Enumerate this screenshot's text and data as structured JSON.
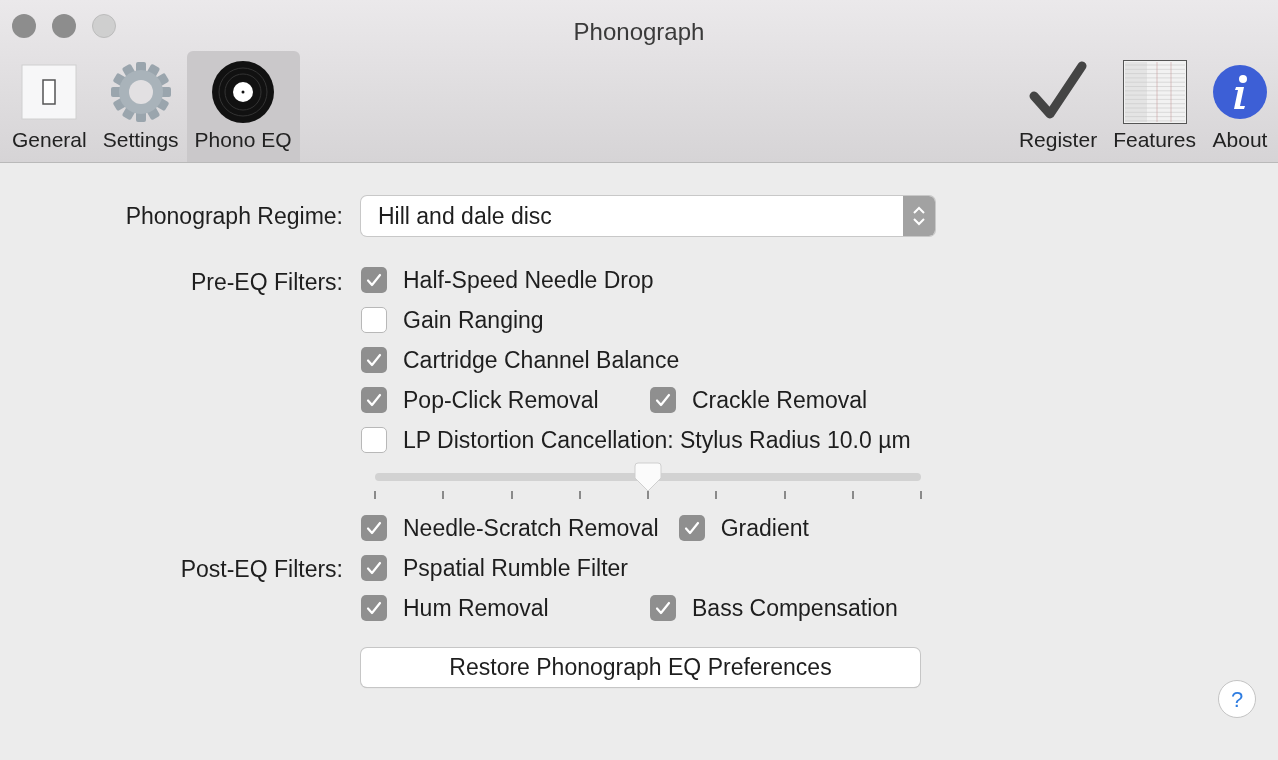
{
  "window": {
    "title": "Phonograph"
  },
  "toolbar": [
    {
      "label": "General",
      "selected": false
    },
    {
      "label": "Settings",
      "selected": false
    },
    {
      "label": "Phono EQ",
      "selected": true
    },
    {
      "label": "Register",
      "selected": false
    },
    {
      "label": "Features",
      "selected": false
    },
    {
      "label": "About",
      "selected": false
    }
  ],
  "regime": {
    "label": "Phonograph Regime:",
    "value": "Hill and dale disc"
  },
  "pre_eq": {
    "label": "Pre-EQ Filters:",
    "rows": [
      {
        "kind": "flow",
        "items": [
          {
            "label": "Half-Speed Needle Drop",
            "checked": true
          }
        ]
      },
      {
        "kind": "flow",
        "items": [
          {
            "label": "Gain Ranging",
            "checked": false
          }
        ]
      },
      {
        "kind": "flow",
        "items": [
          {
            "label": "Cartridge Channel Balance",
            "checked": true
          }
        ]
      },
      {
        "kind": "columns",
        "items": [
          {
            "label": "Pop-Click Removal",
            "checked": true
          },
          {
            "label": "Crackle Removal",
            "checked": true
          }
        ]
      },
      {
        "kind": "flow",
        "items": [
          {
            "label": "LP Distortion Cancellation: Stylus Radius 10.0 µm",
            "checked": false
          }
        ]
      }
    ]
  },
  "slider": {
    "level": 0.5
  },
  "post_eq": {
    "label": "Post-EQ Filters:",
    "rows": [
      {
        "kind": "flow",
        "items": [
          {
            "label": "Needle-Scratch Removal",
            "checked": true
          },
          {
            "label": "Gradient",
            "checked": true
          }
        ]
      },
      {
        "kind": "flow",
        "items": [
          {
            "label": "Pspatial Rumble Filter",
            "checked": true
          }
        ]
      },
      {
        "kind": "columns",
        "items": [
          {
            "label": "Hum Removal",
            "checked": true
          },
          {
            "label": "Bass Compensation",
            "checked": true
          }
        ]
      }
    ]
  },
  "restore_button": "Restore Phonograph EQ Preferences",
  "help_button": "?"
}
